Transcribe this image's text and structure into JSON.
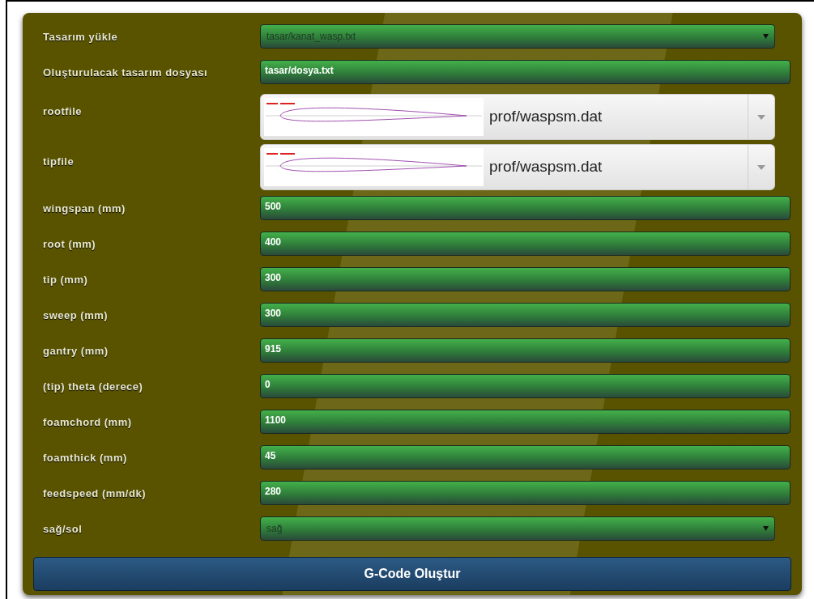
{
  "fields": [
    {
      "kind": "select",
      "label": "Tasarım yükle",
      "value": "tasar/kanat_wasp.txt"
    },
    {
      "kind": "text",
      "label": "Oluşturulacak tasarım dosyası",
      "value": "tasar/dosya.txt"
    },
    {
      "kind": "image_select",
      "label": "rootfile",
      "value": "prof/waspsm.dat"
    },
    {
      "kind": "image_select",
      "label": "tipfile",
      "value": "prof/waspsm.dat"
    },
    {
      "kind": "text",
      "label": "wingspan (mm)",
      "value": "500"
    },
    {
      "kind": "text",
      "label": "root (mm)",
      "value": "400"
    },
    {
      "kind": "text",
      "label": "tip (mm)",
      "value": "300"
    },
    {
      "kind": "text",
      "label": "sweep (mm)",
      "value": "300"
    },
    {
      "kind": "text",
      "label": "gantry (mm)",
      "value": "915"
    },
    {
      "kind": "text",
      "label": "(tip) theta (derece)",
      "value": "0"
    },
    {
      "kind": "text",
      "label": "foamchord (mm)",
      "value": "1100"
    },
    {
      "kind": "text",
      "label": "foamthick (mm)",
      "value": "45"
    },
    {
      "kind": "text",
      "label": "feedspeed (mm/dk)",
      "value": "280"
    },
    {
      "kind": "select",
      "label": "sağ/sol",
      "value": "sağ"
    }
  ],
  "submit_button": "G-Code Oluştur"
}
